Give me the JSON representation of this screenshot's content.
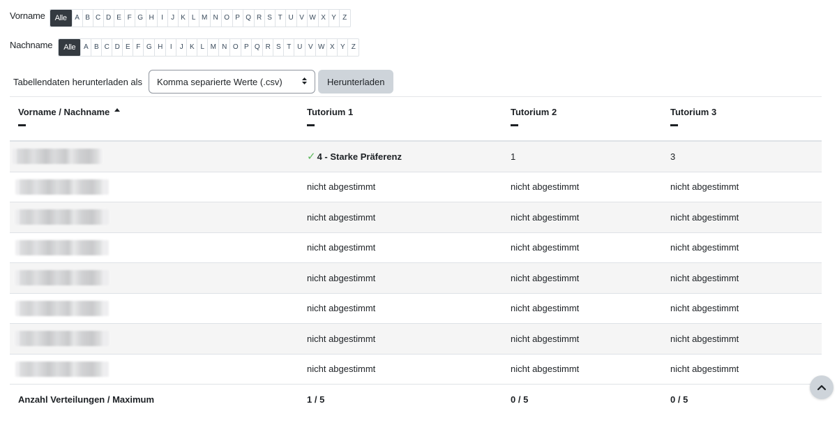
{
  "initials_filter": {
    "first_name": {
      "label": "Vorname",
      "all_label": "Alle",
      "letters": [
        "A",
        "B",
        "C",
        "D",
        "E",
        "F",
        "G",
        "H",
        "I",
        "J",
        "K",
        "L",
        "M",
        "N",
        "O",
        "P",
        "Q",
        "R",
        "S",
        "T",
        "U",
        "V",
        "W",
        "X",
        "Y",
        "Z"
      ]
    },
    "last_name": {
      "label": "Nachname",
      "all_label": "Alle",
      "letters": [
        "A",
        "B",
        "C",
        "D",
        "E",
        "F",
        "G",
        "H",
        "I",
        "J",
        "K",
        "L",
        "M",
        "N",
        "O",
        "P",
        "Q",
        "R",
        "S",
        "T",
        "U",
        "V",
        "W",
        "X",
        "Y",
        "Z"
      ]
    }
  },
  "download": {
    "label": "Tabellendaten herunterladen als",
    "format_selected": "Komma separierte Werte (.csv)",
    "button_label": "Herunterladen"
  },
  "table": {
    "headers": [
      "Vorname / Nachname",
      "Tutorium 1",
      "Tutorium 2",
      "Tutorium 3"
    ],
    "rows": [
      [
        "",
        "4 - Starke Präferenz",
        "1",
        "3"
      ],
      [
        "",
        "nicht abgestimmt",
        "nicht abgestimmt",
        "nicht abgestimmt"
      ],
      [
        "",
        "nicht abgestimmt",
        "nicht abgestimmt",
        "nicht abgestimmt"
      ],
      [
        "",
        "nicht abgestimmt",
        "nicht abgestimmt",
        "nicht abgestimmt"
      ],
      [
        "",
        "nicht abgestimmt",
        "nicht abgestimmt",
        "nicht abgestimmt"
      ],
      [
        "",
        "nicht abgestimmt",
        "nicht abgestimmt",
        "nicht abgestimmt"
      ],
      [
        "",
        "nicht abgestimmt",
        "nicht abgestimmt",
        "nicht abgestimmt"
      ],
      [
        "",
        "nicht abgestimmt",
        "nicht abgestimmt",
        "nicht abgestimmt"
      ]
    ],
    "footer": [
      "Anzahl Verteilungen / Maximum",
      "1 / 5",
      "0 / 5",
      "0 / 5"
    ]
  },
  "icons": {
    "sort": "sort-ascending-icon",
    "collapse": "collapse-column-icon",
    "check": "check-icon",
    "select_arrow": "select-arrows-icon",
    "scroll_top": "chevron-up-icon"
  },
  "colors": {
    "active_letter_bg": "#343a40",
    "check_color": "#5cb85c",
    "button_bg": "#ced4da",
    "stripe_bg": "#f5f5f5"
  }
}
